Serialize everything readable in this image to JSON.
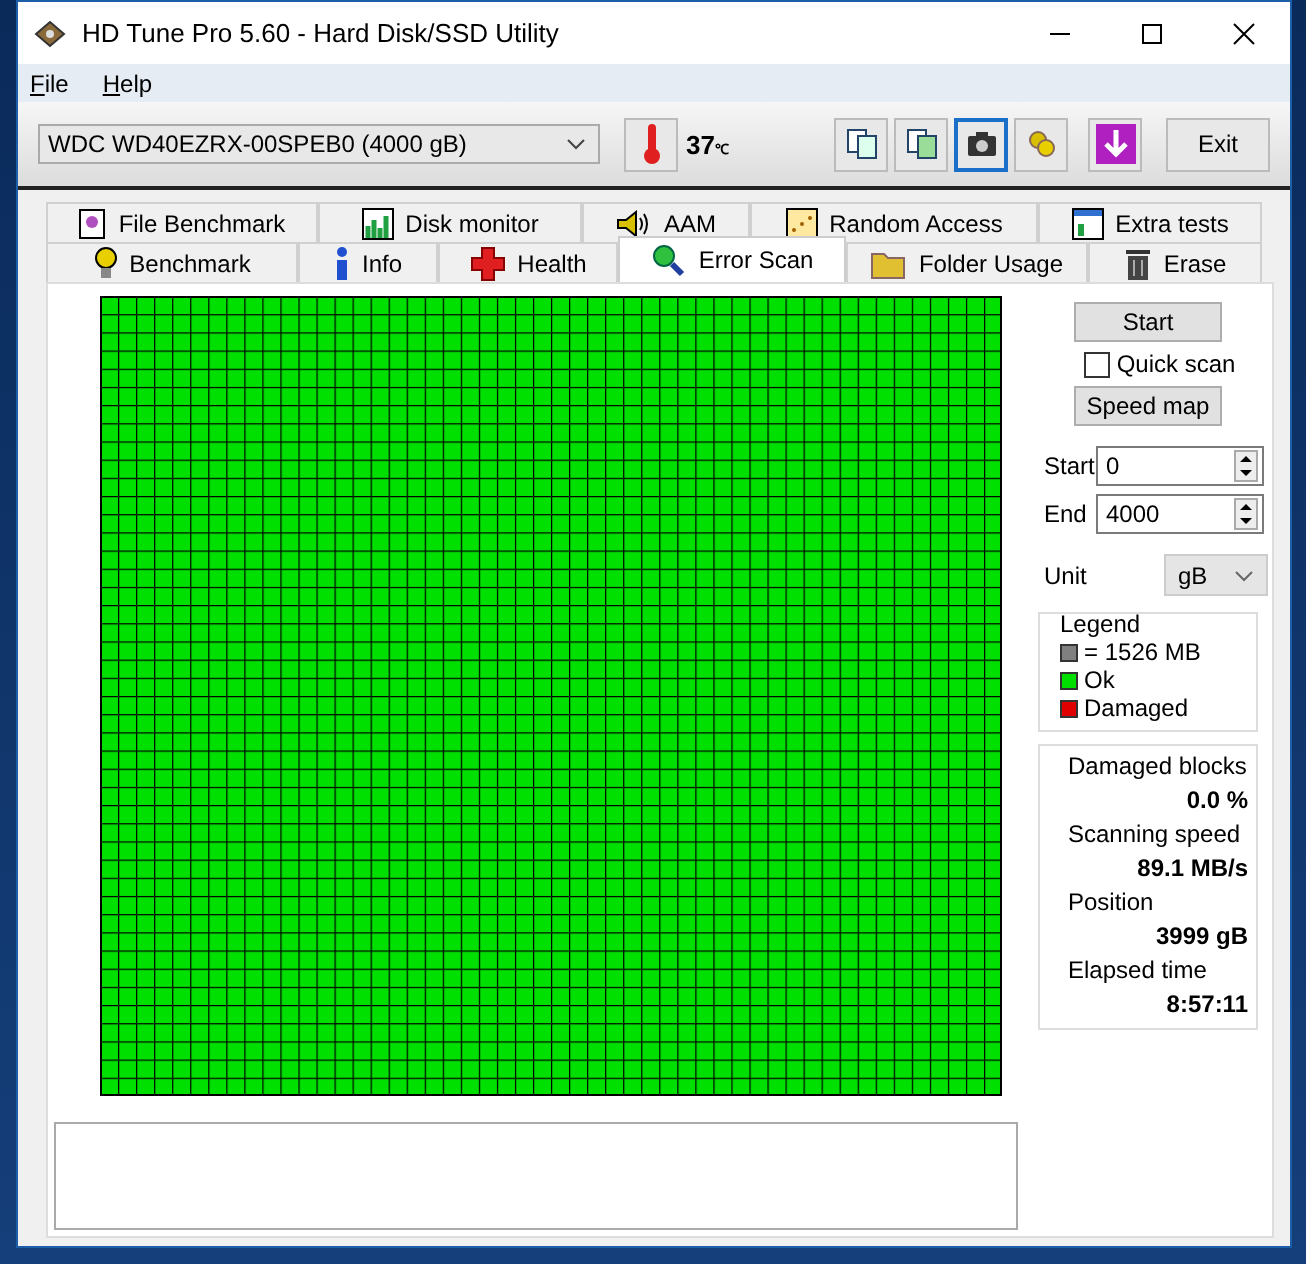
{
  "window": {
    "title": "HD Tune Pro 5.60 - Hard Disk/SSD Utility"
  },
  "menu": [
    {
      "label": "File"
    },
    {
      "label": "Help"
    }
  ],
  "toolbar": {
    "drive": "WDC WD40EZRX-00SPEB0 (4000 gB)",
    "temperature": "37",
    "temperature_unit": "℃",
    "buttons": [
      {
        "kind": "copy",
        "focused": false
      },
      {
        "kind": "copy-all",
        "focused": false
      },
      {
        "kind": "screenshot",
        "focused": true
      },
      {
        "kind": "options",
        "focused": false
      },
      {
        "kind": "save",
        "focused": false
      }
    ],
    "exit": "Exit"
  },
  "tabs_back": [
    {
      "label": "File Benchmark",
      "kind": "filebench",
      "selected": false
    },
    {
      "label": "Disk monitor",
      "kind": "monitor",
      "selected": false
    },
    {
      "label": "AAM",
      "kind": "aam",
      "selected": false
    },
    {
      "label": "Random Access",
      "kind": "random",
      "selected": false
    },
    {
      "label": "Extra tests",
      "kind": "extra",
      "selected": false
    }
  ],
  "tabs_front": [
    {
      "label": "Benchmark",
      "kind": "bench",
      "selected": false
    },
    {
      "label": "Info",
      "kind": "info",
      "selected": false
    },
    {
      "label": "Health",
      "kind": "health",
      "selected": false
    },
    {
      "label": "Error Scan",
      "kind": "scan",
      "selected": true
    },
    {
      "label": "Folder Usage",
      "kind": "folder",
      "selected": false
    },
    {
      "label": "Erase",
      "kind": "erase",
      "selected": false
    }
  ],
  "block_map": {
    "damaged": false
  },
  "controls": {
    "start_button": "Start",
    "quick_scan": {
      "label": "Quick scan",
      "checked": false
    },
    "speed_map_button": "Speed map",
    "start_label": "Start",
    "start_value": "0",
    "end_label": "End",
    "end_value": "4000",
    "unit_label": "Unit",
    "unit_value": "gB"
  },
  "legend": {
    "title": "Legend",
    "items": [
      {
        "label": "= 1526 MB",
        "color": "#808080"
      },
      {
        "label": "Ok",
        "color": "#00e000"
      },
      {
        "label": "Damaged",
        "color": "#e00000"
      }
    ]
  },
  "stats": [
    {
      "label": "Damaged blocks",
      "value": "0.0 %"
    },
    {
      "label": "Scanning speed",
      "value": "89.1 MB/s"
    },
    {
      "label": "Position",
      "value": "3999 gB"
    },
    {
      "label": "Elapsed time",
      "value": "8:57:11"
    }
  ]
}
